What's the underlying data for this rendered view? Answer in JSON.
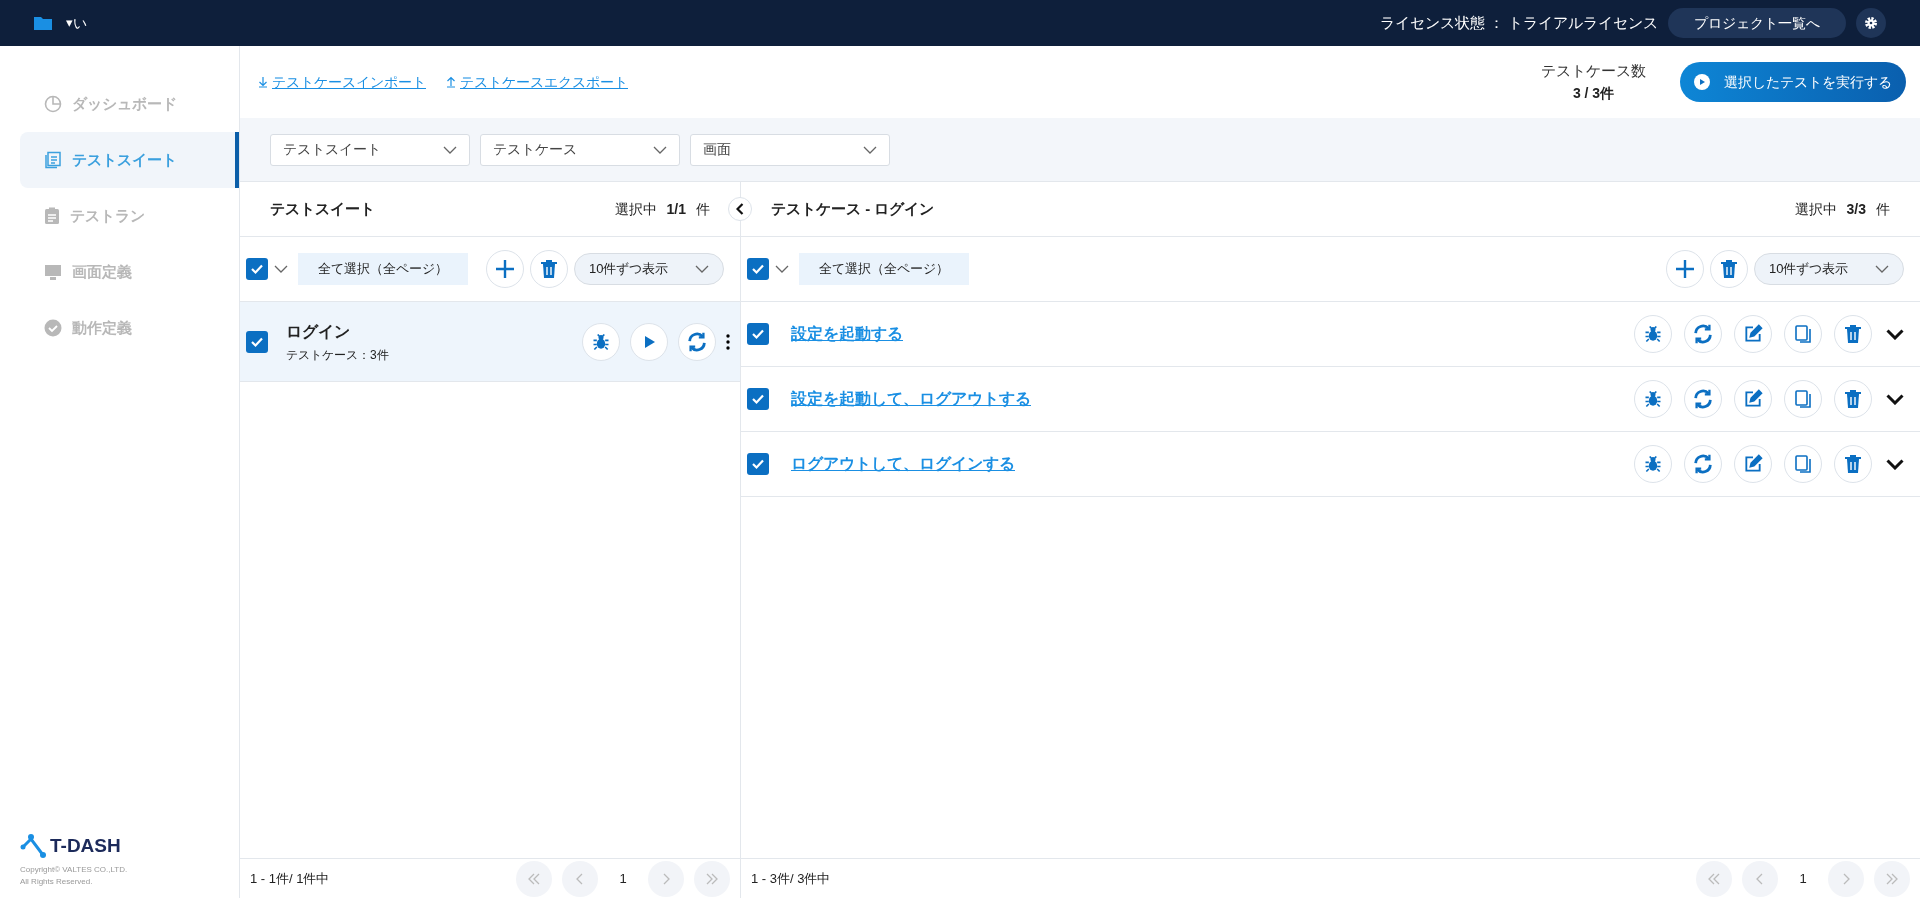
{
  "top_bar": {
    "project_caret": "▾",
    "project_name": "い",
    "license": "ライセンス状態 ： トライアルライセンス",
    "projects_button": "プロジェクト一覧へ"
  },
  "sidebar": {
    "items": [
      {
        "label": "ダッシュボード",
        "selected": false
      },
      {
        "label": "テストスイート",
        "selected": true
      },
      {
        "label": "テストラン",
        "selected": false
      },
      {
        "label": "画面定義",
        "selected": false
      },
      {
        "label": "動作定義",
        "selected": false
      }
    ],
    "logo": "T-DASH",
    "copyright": "Copyright© VALTES CO.,LTD.",
    "rights": "All Rights Reserved."
  },
  "links": [
    {
      "label": "テストケースインポート",
      "kind": "import"
    },
    {
      "label": "テストケースエクスポート",
      "kind": "export"
    }
  ],
  "testcase_count": {
    "label": "テストケース数",
    "value": "3 / 3件"
  },
  "run_button": "選択したテストを実行する",
  "filters": [
    "テストスイート",
    "テストケース",
    "画面"
  ],
  "suite_panel": {
    "title": "テストスイート",
    "selected_label": "選択中",
    "selected_count": "1/1",
    "unit": "件",
    "select_all_checked": true,
    "select_all_label": "全て選択（全ページ）",
    "page_size": "10件ずつ表示",
    "suites": [
      {
        "name": "ログイン",
        "subtitle": "テストケース：3件",
        "checked": true,
        "selected": true
      }
    ],
    "range": "1 - 1件/ 1件中",
    "page": "1"
  },
  "case_panel": {
    "title": "テストケース - ログイン",
    "selected_label": "選択中",
    "selected_count": "3/3",
    "unit": "件",
    "select_all_checked": true,
    "select_all_label": "全て選択（全ページ）",
    "page_size": "10件ずつ表示",
    "cases": [
      {
        "name": "設定を起動する",
        "checked": true
      },
      {
        "name": "設定を起動して、ログアウトする",
        "checked": true
      },
      {
        "name": "ログアウトして、ログインする",
        "checked": true
      }
    ],
    "range": "1 - 3件/ 3件中",
    "page": "1"
  }
}
